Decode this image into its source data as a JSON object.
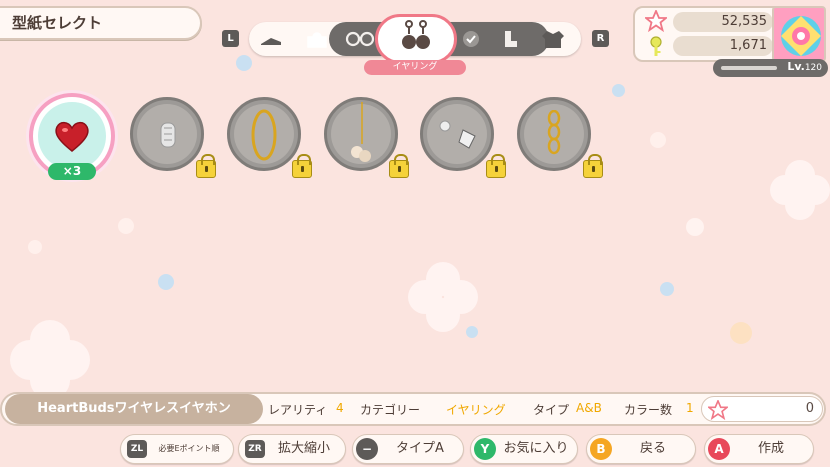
{
  "header": {
    "title": "型紙セレクト"
  },
  "shoulder": {
    "left": "L",
    "right": "R"
  },
  "category_tabs": {
    "selected_label": "イヤリング",
    "icons": [
      "shoes-icon",
      "bag-icon",
      "glasses-icon",
      "earring-icon",
      "check-icon",
      "boots-icon",
      "shirt-icon"
    ]
  },
  "currency": {
    "stars": "52,535",
    "keys": "1,671"
  },
  "level": {
    "prefix": "Lv.",
    "value": "120"
  },
  "selected_item": {
    "count": "×3"
  },
  "items": [
    {
      "name": "heart-earring",
      "locked": false
    },
    {
      "name": "silver-cuff",
      "locked": true
    },
    {
      "name": "gold-hoop",
      "locked": true
    },
    {
      "name": "pearl-drop",
      "locked": true
    },
    {
      "name": "crystal-stud",
      "locked": true
    },
    {
      "name": "gold-chain",
      "locked": true
    }
  ],
  "info": {
    "item_name": "HeartBudsワイヤレスイヤホン",
    "rarity_label": "レアリティ",
    "rarity_value": "4",
    "category_label": "カテゴリー",
    "category_value": "イヤリング",
    "type_label": "タイプ",
    "type_value": "A&B",
    "color_label": "カラー数",
    "color_value": "1",
    "points": "0"
  },
  "buttons": {
    "zl_key": "ZL",
    "zl_label": "必要Eポイント順",
    "zr_key": "ZR",
    "zr_label": "拡大縮小",
    "minus_key": "−",
    "minus_label": "タイプA",
    "y_key": "Y",
    "y_label": "お気に入り",
    "b_key": "B",
    "b_label": "戻る",
    "a_key": "A",
    "a_label": "作成"
  },
  "colors": {
    "accent_pink": "#f08896",
    "bg": "#fbe4df",
    "gold": "#f0a800",
    "green": "#2eb86a"
  }
}
